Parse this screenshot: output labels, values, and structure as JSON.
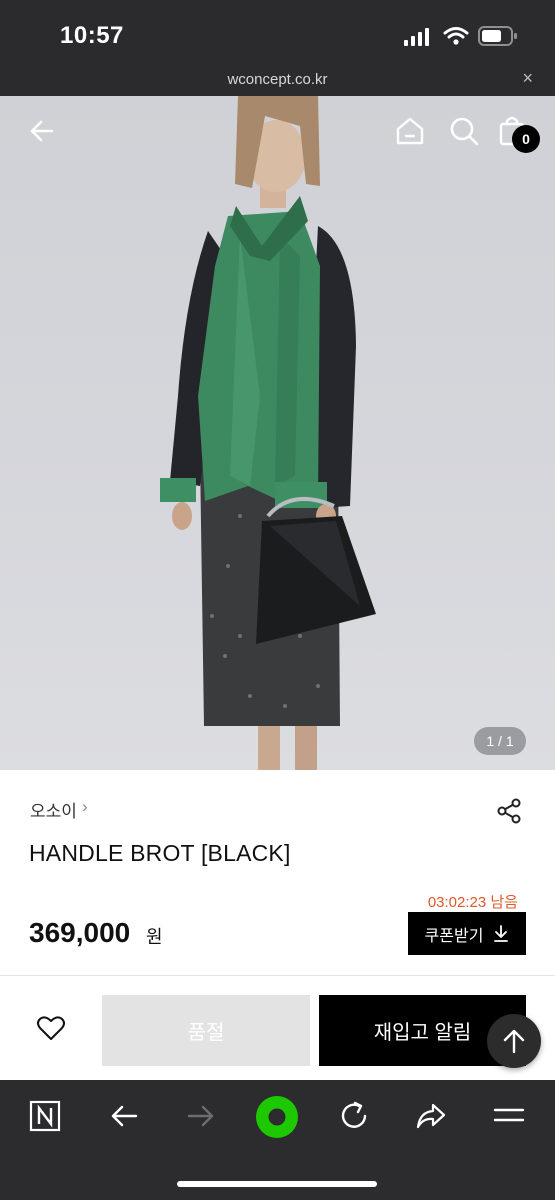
{
  "status_bar": {
    "time": "10:57"
  },
  "browser": {
    "url": "wconcept.co.kr",
    "close_label": "×"
  },
  "hero": {
    "image_counter": "1 / 1",
    "cart_count": "0"
  },
  "product": {
    "brand": "오소이",
    "brand_chevron": "›",
    "name": "HANDLE BROT [BLACK]",
    "time_left": "03:02:23 남음",
    "price": "369,000",
    "price_unit": "원",
    "coupon_label": "쿠폰받기"
  },
  "actions": {
    "soldout_label": "품절",
    "restock_label": "재입고 알림"
  },
  "colors": {
    "accent_orange": "#e0582b",
    "black": "#000000",
    "soldout_gray": "#e3e3e3",
    "naver_green": "#1ec800"
  },
  "icons": {
    "back": "arrow-left-icon",
    "home": "home-icon",
    "search": "search-icon",
    "cart": "shopping-bag-icon",
    "share": "share-icon",
    "wishlist": "heart-icon",
    "scroll_top": "arrow-up-icon",
    "download": "download-icon"
  }
}
